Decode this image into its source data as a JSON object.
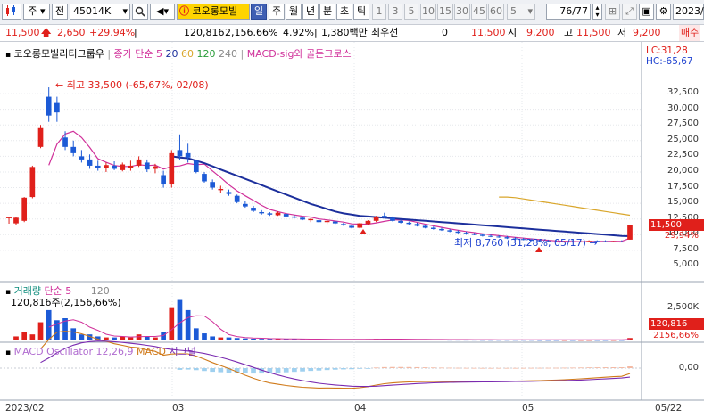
{
  "toolbar": {
    "market": "주",
    "market_mode": "전",
    "code": "45014K",
    "mode_active": "일",
    "periods": [
      "주",
      "월",
      "년",
      "분",
      "초",
      "틱"
    ],
    "numbers": [
      "1",
      "3",
      "5",
      "10",
      "15",
      "30",
      "45",
      "60"
    ],
    "period_n": "5",
    "page": "76/77",
    "date": "2023/"
  },
  "stock_name": "코오롱모빌",
  "info": {
    "price": "11,500",
    "change": "2,650",
    "change_pct": "+29.94%",
    "volume": "120,816",
    "volume_pct": "2,156.66%",
    "turnover": "4.92%",
    "amount": "1,380백만",
    "best_ask_label": "최우선",
    "best_ask": "0",
    "best_bid": "11,500",
    "open_label": "시",
    "open": "9,200",
    "high_label": "고",
    "high": "11,500",
    "low_label": "저",
    "low": "9,200",
    "side": "매수"
  },
  "price_panel": {
    "title": "코오롱모빌리티그룹우",
    "ma_label": "종가 단순",
    "ma": [
      "5",
      "20",
      "60",
      "120",
      "240"
    ],
    "macd_signal_label": "MACD-sig와 골든크로스",
    "lc": "LC:31,28",
    "hc": "HC:-65,67",
    "max_annot": "최고 33,500 (-65,67%, 02/08)",
    "min_annot": "최저 8,760 (31,28%, 05/17)",
    "current_price": "11,500",
    "current_pct": "29,94%",
    "t_marker": "T",
    "y_ticks": [
      "32,500",
      "30,000",
      "27,500",
      "25,000",
      "22,500",
      "20,000",
      "17,500",
      "15,000",
      "12,500",
      "10,000",
      "7,500",
      "5,000"
    ]
  },
  "volume_panel": {
    "title": "거래량",
    "ma_label": "단순",
    "ma": [
      "5",
      "120"
    ],
    "annot": "120,816주(2,156,66%)",
    "y_tick": "2,500K",
    "current": "120,816",
    "current_pct": "2156,66%"
  },
  "macd_panel": {
    "title": "MACD Oscillator 12,26,9",
    "macd": "MACD",
    "signal": "시그널",
    "zero": "0,00"
  },
  "dates": [
    "2023/02",
    "03",
    "04",
    "05",
    "05/22"
  ],
  "colors": {
    "up": "#e0201b",
    "down": "#1c5ad6",
    "ma5": "#d0309a",
    "ma20": "#1c2f9c",
    "ma60": "#d9a62b",
    "accent": "#ffd400"
  },
  "chart_data": {
    "type": "candlestick",
    "candles": [
      {
        "o": 11800,
        "h": 12800,
        "l": 11600,
        "c": 12700
      },
      {
        "o": 12200,
        "h": 16000,
        "l": 12000,
        "c": 15900
      },
      {
        "o": 16000,
        "h": 21000,
        "l": 15800,
        "c": 20800
      },
      {
        "o": 24000,
        "h": 27500,
        "l": 23800,
        "c": 27000
      },
      {
        "o": 32000,
        "h": 33500,
        "l": 28000,
        "c": 29000
      },
      {
        "o": 31000,
        "h": 32000,
        "l": 28000,
        "c": 29500
      },
      {
        "o": 25500,
        "h": 26500,
        "l": 23500,
        "c": 24000
      },
      {
        "o": 24000,
        "h": 25000,
        "l": 22500,
        "c": 23000
      },
      {
        "o": 22500,
        "h": 23500,
        "l": 21500,
        "c": 22000
      },
      {
        "o": 22000,
        "h": 22800,
        "l": 20500,
        "c": 21000
      },
      {
        "o": 21000,
        "h": 21800,
        "l": 20200,
        "c": 20600
      },
      {
        "o": 20700,
        "h": 21500,
        "l": 20000,
        "c": 21100
      },
      {
        "o": 21000,
        "h": 21700,
        "l": 20300,
        "c": 20500
      },
      {
        "o": 20300,
        "h": 21500,
        "l": 20100,
        "c": 21200
      },
      {
        "o": 20600,
        "h": 21800,
        "l": 20200,
        "c": 21000
      },
      {
        "o": 21000,
        "h": 22500,
        "l": 20800,
        "c": 22000
      },
      {
        "o": 21500,
        "h": 22000,
        "l": 20000,
        "c": 20400
      },
      {
        "o": 20500,
        "h": 21300,
        "l": 19800,
        "c": 20900
      },
      {
        "o": 19500,
        "h": 20200,
        "l": 17500,
        "c": 18000
      },
      {
        "o": 18000,
        "h": 23500,
        "l": 17500,
        "c": 23000
      },
      {
        "o": 23500,
        "h": 26000,
        "l": 22000,
        "c": 22500
      },
      {
        "o": 23000,
        "h": 24500,
        "l": 21500,
        "c": 22300
      },
      {
        "o": 21800,
        "h": 22000,
        "l": 19800,
        "c": 20000
      },
      {
        "o": 19700,
        "h": 20000,
        "l": 18300,
        "c": 18500
      },
      {
        "o": 18400,
        "h": 18800,
        "l": 17200,
        "c": 17500
      },
      {
        "o": 17100,
        "h": 17800,
        "l": 16700,
        "c": 17300
      },
      {
        "o": 16800,
        "h": 17200,
        "l": 16200,
        "c": 16500
      },
      {
        "o": 16200,
        "h": 16400,
        "l": 15000,
        "c": 15200
      },
      {
        "o": 14900,
        "h": 15300,
        "l": 14300,
        "c": 14500
      },
      {
        "o": 14300,
        "h": 14600,
        "l": 13600,
        "c": 13800
      },
      {
        "o": 13600,
        "h": 13900,
        "l": 13200,
        "c": 13400
      },
      {
        "o": 13400,
        "h": 13600,
        "l": 13000,
        "c": 13200
      },
      {
        "o": 13100,
        "h": 13700,
        "l": 13000,
        "c": 13500
      },
      {
        "o": 13300,
        "h": 13400,
        "l": 12800,
        "c": 12900
      },
      {
        "o": 12900,
        "h": 13100,
        "l": 12600,
        "c": 12700
      },
      {
        "o": 12700,
        "h": 12900,
        "l": 12300,
        "c": 12400
      },
      {
        "o": 12300,
        "h": 12600,
        "l": 12000,
        "c": 12500
      },
      {
        "o": 12300,
        "h": 12400,
        "l": 11900,
        "c": 12000
      },
      {
        "o": 12000,
        "h": 12300,
        "l": 11700,
        "c": 12200
      },
      {
        "o": 12100,
        "h": 12200,
        "l": 11700,
        "c": 11800
      },
      {
        "o": 11700,
        "h": 11900,
        "l": 11400,
        "c": 11500
      },
      {
        "o": 11400,
        "h": 11600,
        "l": 11000,
        "c": 11100
      },
      {
        "o": 11100,
        "h": 11900,
        "l": 11000,
        "c": 11800
      },
      {
        "o": 11700,
        "h": 12300,
        "l": 11600,
        "c": 12200
      },
      {
        "o": 12200,
        "h": 13000,
        "l": 12000,
        "c": 12800
      },
      {
        "o": 13000,
        "h": 13500,
        "l": 12600,
        "c": 12700
      },
      {
        "o": 12700,
        "h": 12900,
        "l": 12100,
        "c": 12200
      },
      {
        "o": 12200,
        "h": 12400,
        "l": 11800,
        "c": 11900
      },
      {
        "o": 11900,
        "h": 12100,
        "l": 11600,
        "c": 11700
      },
      {
        "o": 11700,
        "h": 11900,
        "l": 11300,
        "c": 11400
      },
      {
        "o": 11400,
        "h": 11500,
        "l": 11000,
        "c": 11100
      },
      {
        "o": 11100,
        "h": 11300,
        "l": 10800,
        "c": 10900
      },
      {
        "o": 10900,
        "h": 11100,
        "l": 10600,
        "c": 10700
      },
      {
        "o": 10700,
        "h": 10900,
        "l": 10400,
        "c": 10500
      },
      {
        "o": 10500,
        "h": 10700,
        "l": 10200,
        "c": 10300
      },
      {
        "o": 10300,
        "h": 10500,
        "l": 10000,
        "c": 10100
      },
      {
        "o": 10100,
        "h": 10300,
        "l": 9900,
        "c": 10000
      },
      {
        "o": 10000,
        "h": 10100,
        "l": 9700,
        "c": 9800
      },
      {
        "o": 9800,
        "h": 10000,
        "l": 9600,
        "c": 9700
      },
      {
        "o": 9700,
        "h": 9900,
        "l": 9500,
        "c": 9600
      },
      {
        "o": 9600,
        "h": 9800,
        "l": 9300,
        "c": 9400
      },
      {
        "o": 9400,
        "h": 9600,
        "l": 9200,
        "c": 9300
      },
      {
        "o": 9300,
        "h": 9500,
        "l": 9100,
        "c": 9200
      },
      {
        "o": 9200,
        "h": 9400,
        "l": 9000,
        "c": 9100
      },
      {
        "o": 9100,
        "h": 9300,
        "l": 8900,
        "c": 9000
      },
      {
        "o": 9000,
        "h": 9200,
        "l": 8800,
        "c": 8900
      },
      {
        "o": 8900,
        "h": 9100,
        "l": 8760,
        "c": 8850
      },
      {
        "o": 8850,
        "h": 9000,
        "l": 8800,
        "c": 8900
      },
      {
        "o": 8900,
        "h": 9100,
        "l": 8800,
        "c": 8850
      },
      {
        "o": 8850,
        "h": 9000,
        "l": 8800,
        "c": 8900
      },
      {
        "o": 8900,
        "h": 9100,
        "l": 8850,
        "c": 9000
      },
      {
        "o": 9000,
        "h": 9100,
        "l": 8900,
        "c": 8950
      },
      {
        "o": 8950,
        "h": 9100,
        "l": 8850,
        "c": 8900
      },
      {
        "o": 8900,
        "h": 9000,
        "l": 8800,
        "c": 8950
      },
      {
        "o": 8900,
        "h": 9100,
        "l": 8850,
        "c": 8850
      },
      {
        "o": 9200,
        "h": 11500,
        "l": 9200,
        "c": 11500
      }
    ],
    "volume": [
      200,
      400,
      300,
      900,
      1500,
      1000,
      1100,
      600,
      300,
      300,
      200,
      150,
      150,
      200,
      150,
      300,
      200,
      150,
      400,
      1600,
      2000,
      1500,
      600,
      350,
      200,
      150,
      150,
      120,
      100,
      90,
      80,
      80,
      80,
      70,
      70,
      60,
      60,
      60,
      60,
      50,
      50,
      50,
      60,
      70,
      80,
      70,
      60,
      55,
      50,
      50,
      45,
      45,
      45,
      40,
      40,
      40,
      40,
      35,
      35,
      35,
      35,
      35,
      35,
      35,
      30,
      30,
      30,
      30,
      30,
      30,
      30,
      30,
      30,
      30,
      30,
      120
    ],
    "ma20": [
      null,
      null,
      null,
      null,
      null,
      null,
      null,
      null,
      null,
      null,
      null,
      null,
      null,
      null,
      null,
      null,
      null,
      null,
      null,
      22500,
      22300,
      22200,
      21800,
      21400,
      20900,
      20400,
      19900,
      19400,
      18900,
      18400,
      17900,
      17400,
      16900,
      16400,
      15900,
      15400,
      14900,
      14500,
      14100,
      13700,
      13400,
      13200,
      13000,
      12900,
      12800,
      12700,
      12600,
      12500,
      12400,
      12300,
      12200,
      12100,
      12000,
      11900,
      11800,
      11700,
      11600,
      11500,
      11400,
      11300,
      11200,
      11100,
      11000,
      10900,
      10800,
      10700,
      10600,
      10500,
      10400,
      10300,
      10200,
      10100,
      10000,
      9900,
      9800,
      9750
    ],
    "ma60": [
      null,
      null,
      null,
      null,
      null,
      null,
      null,
      null,
      null,
      null,
      null,
      null,
      null,
      null,
      null,
      null,
      null,
      null,
      null,
      null,
      null,
      null,
      null,
      null,
      null,
      null,
      null,
      null,
      null,
      null,
      null,
      null,
      null,
      null,
      null,
      null,
      null,
      null,
      null,
      null,
      null,
      null,
      null,
      null,
      null,
      null,
      null,
      null,
      null,
      null,
      null,
      null,
      null,
      null,
      null,
      null,
      null,
      null,
      null,
      16000,
      16000,
      15900,
      15700,
      15500,
      15300,
      15100,
      14900,
      14700,
      14500,
      14300,
      14100,
      13900,
      13700,
      13500,
      13300,
      13100
    ],
    "ylim": [
      3500,
      34500
    ]
  }
}
